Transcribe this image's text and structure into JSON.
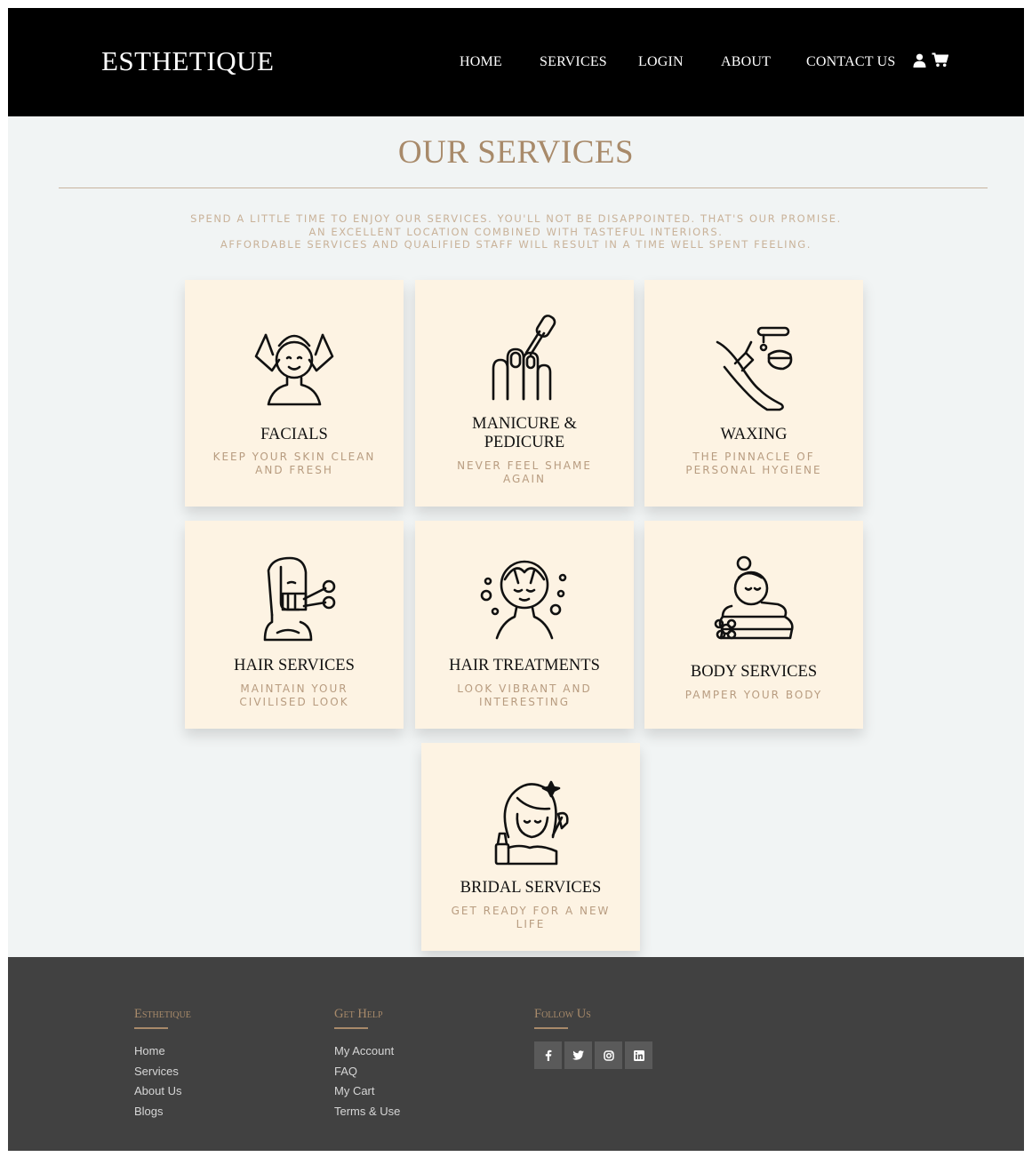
{
  "header": {
    "brand": "ESTHETIQUE",
    "nav": [
      "HOME",
      "SERVICES",
      "LOGIN",
      "ABOUT",
      "CONTACT US"
    ],
    "icons": [
      "user-icon",
      "cart-icon"
    ]
  },
  "main": {
    "title": "OUR SERVICES",
    "intro": [
      "SPEND A LITTLE TIME TO ENJOY OUR SERVICES. YOU'LL NOT BE DISAPPOINTED. THAT'S OUR PROMISE.",
      "AN EXCELLENT LOCATION COMBINED WITH TASTEFUL INTERIORS.",
      "AFFORDABLE SERVICES AND QUALIFIED STAFF WILL RESULT IN A TIME WELL SPENT FEELING."
    ],
    "services": [
      {
        "title": "FACIALS",
        "title2": "",
        "sub": "KEEP YOUR SKIN CLEAN",
        "sub2": "AND FRESH",
        "icon": "facial-massage-icon"
      },
      {
        "title": "MANICURE &",
        "title2": "PEDICURE",
        "sub": "NEVER FEEL SHAME",
        "sub2": "AGAIN",
        "icon": "nail-polish-icon"
      },
      {
        "title": "WAXING",
        "title2": "",
        "sub": "THE PINNACLE OF",
        "sub2": "PERSONAL HYGIENE",
        "icon": "leg-waxing-icon"
      },
      {
        "title": "HAIR SERVICES",
        "title2": "",
        "sub": "MAINTAIN YOUR",
        "sub2": "CIVILISED LOOK",
        "icon": "hair-straightener-icon"
      },
      {
        "title": "HAIR TREATMENTS",
        "title2": "",
        "sub": "LOOK VIBRANT AND",
        "sub2": "INTERESTING",
        "icon": "hair-wash-icon"
      },
      {
        "title": "BODY SERVICES",
        "title2": "",
        "sub": "PAMPER YOUR BODY",
        "sub2": "",
        "icon": "body-massage-icon"
      },
      {
        "title": "BRIDAL SERVICES",
        "title2": "",
        "sub": "GET READY FOR A NEW",
        "sub2": "LIFE",
        "icon": "bridal-makeup-icon"
      }
    ]
  },
  "footer": {
    "col1": {
      "heading": "Esthetique",
      "links": [
        "Home",
        "Services",
        "About Us",
        "Blogs"
      ]
    },
    "col2": {
      "heading": "Get Help",
      "links": [
        "My Account",
        "FAQ",
        "My Cart",
        "Terms & Use"
      ]
    },
    "col3": {
      "heading": "Follow Us",
      "social": [
        {
          "label": "f",
          "icon": "facebook-icon"
        },
        {
          "label": "t",
          "icon": "twitter-icon"
        },
        {
          "label": "i",
          "icon": "instagram-icon"
        },
        {
          "label": "in",
          "icon": "linkedin-icon"
        }
      ]
    }
  },
  "colors": {
    "accent": "#a88a6a",
    "card_bg": "#fdf3e3",
    "header_bg": "#000000",
    "footer_bg": "#414141",
    "page_bg": "#f1f4f4"
  }
}
